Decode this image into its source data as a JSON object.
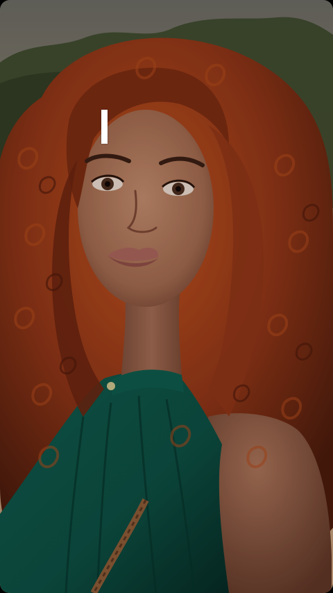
{
  "photo": {
    "subject": "portrait",
    "colors": {
      "sky_top": "#6b6a63",
      "sky_glow": "#c9a07a",
      "foliage": "#3d4a2c",
      "hair_dark": "#5e2410",
      "hair_mid": "#8e3517",
      "hair_light": "#c2531f",
      "skin": "#b07a5e",
      "skin_shadow": "#7e4f3c",
      "lips": "#a8645c",
      "top_fabric": "#0f5448",
      "top_fabric_dark": "#083a31",
      "braid_trim": "#8a5a36"
    }
  },
  "overlay": {
    "cursor_color": "#ffffff"
  }
}
